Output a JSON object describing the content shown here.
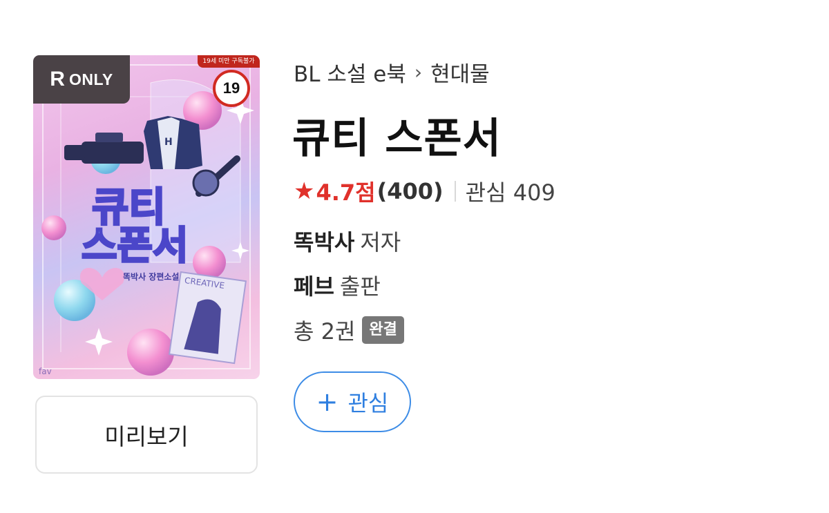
{
  "cover": {
    "badge_r": "R",
    "badge_only": "ONLY",
    "age_notice": "19세 미만 구독불가",
    "age_rating": "19",
    "art_title_line1": "큐티",
    "art_title_line2": "스폰서",
    "art_author": "똑박사 장편소설",
    "art_publisher_logo": "fav"
  },
  "preview_button": {
    "label": "미리보기"
  },
  "breadcrumb": {
    "category": "BL 소설 e북",
    "separator": "›",
    "subcategory": "현대물"
  },
  "book": {
    "title": "큐티 스폰서",
    "rating_score": "4.7점",
    "rating_count": "(400)",
    "favorite_label": "관심 409",
    "author_name": "똑박사",
    "author_role": "저자",
    "publisher_name": "페브",
    "publisher_role": "출판",
    "volumes": "총 2권",
    "status_badge": "완결"
  },
  "favorite_button": {
    "icon": "plus-icon",
    "label": "관심"
  },
  "colors": {
    "accent_red": "#e0312b",
    "accent_blue": "#2f7fe0",
    "badge_gray": "#777777"
  }
}
